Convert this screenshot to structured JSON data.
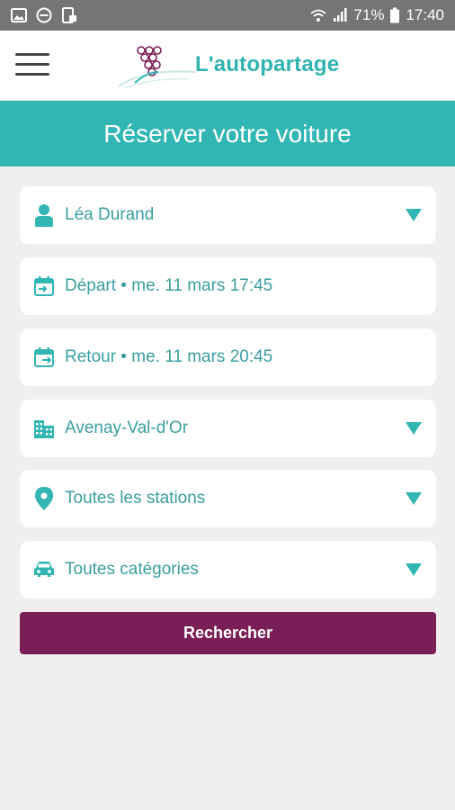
{
  "status_bar": {
    "battery": "71%",
    "time": "17:40",
    "icons": [
      "image-icon",
      "minus-circle-icon",
      "phone-lock-icon",
      "wifi-icon",
      "signal-icon",
      "battery-icon"
    ]
  },
  "header": {
    "brand": "L'autopartage",
    "menu_icon": "hamburger-icon",
    "logo": "grapes-logo"
  },
  "banner": {
    "title": "Réserver votre voiture"
  },
  "form": {
    "user": {
      "label": "Léa Durand",
      "icon": "person-icon"
    },
    "departure": {
      "label": "Départ • me. 11 mars 17:45",
      "icon": "calendar-arrow-in-icon"
    },
    "return": {
      "label": "Retour • me. 11 mars 20:45",
      "icon": "calendar-arrow-out-icon"
    },
    "city": {
      "label": "Avenay-Val-d'Or",
      "icon": "buildings-icon"
    },
    "station": {
      "label": "Toutes les stations",
      "icon": "map-pin-icon"
    },
    "category": {
      "label": "Toutes catégories",
      "icon": "car-icon"
    },
    "search_button": "Rechercher"
  },
  "colors": {
    "teal": "#31b6b3",
    "teal_text": "#3a9fa0",
    "purple": "#7a1f56",
    "status_bar": "#757575"
  }
}
